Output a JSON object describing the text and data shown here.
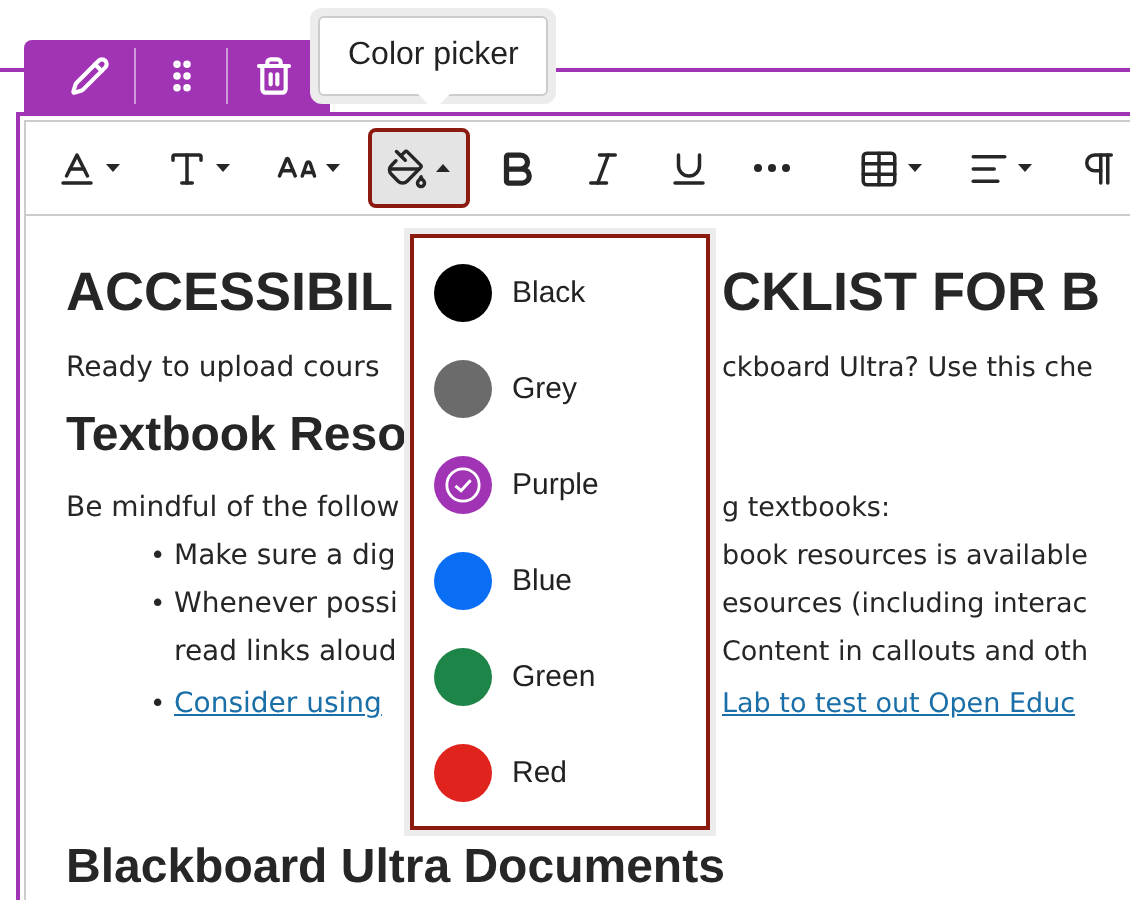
{
  "tooltip": {
    "text": "Color picker"
  },
  "block_toolbar": {
    "tools": [
      {
        "kind": "edit"
      },
      {
        "kind": "move"
      },
      {
        "kind": "delete"
      }
    ]
  },
  "toolbar": {
    "groups": [
      [
        {
          "kind": "font-style",
          "caret": true,
          "selected": false
        },
        {
          "kind": "text-type",
          "caret": true,
          "selected": false
        },
        {
          "kind": "font-size",
          "caret": true,
          "selected": false
        },
        {
          "kind": "color",
          "caret": true,
          "selected": true
        },
        {
          "kind": "bold",
          "caret": false,
          "selected": false
        },
        {
          "kind": "italic",
          "caret": false,
          "selected": false
        },
        {
          "kind": "underline",
          "caret": false,
          "selected": false
        },
        {
          "kind": "more",
          "caret": false,
          "selected": false
        }
      ],
      [
        {
          "kind": "table",
          "caret": true,
          "selected": false
        },
        {
          "kind": "align",
          "caret": true,
          "selected": false
        },
        {
          "kind": "paragraph",
          "caret": false,
          "selected": false
        }
      ]
    ]
  },
  "color_menu": {
    "items": [
      {
        "label": "Black",
        "color": "#000000",
        "selected": false
      },
      {
        "label": "Grey",
        "color": "#6b6b6b",
        "selected": false
      },
      {
        "label": "Purple",
        "color": "#a034b4",
        "selected": true
      },
      {
        "label": "Blue",
        "color": "#0a6ef5",
        "selected": false
      },
      {
        "label": "Green",
        "color": "#1e8548",
        "selected": false
      },
      {
        "label": "Red",
        "color": "#e0231c",
        "selected": false
      }
    ]
  },
  "document": {
    "lines": [
      {
        "kind": "h1",
        "left": "ACCESSIBIL",
        "right": "CKLIST FOR B"
      },
      {
        "kind": "p",
        "left": "Ready to upload cours",
        "right": "ckboard Ultra? Use this che"
      },
      {
        "kind": "h2",
        "left": "Textbook Reso"
      },
      {
        "kind": "p",
        "left": "Be mindful of the follow",
        "right": "g textbooks:"
      },
      {
        "kind": "bullet",
        "marker": "•",
        "left": "Make sure a dig",
        "right": "book resources is available"
      },
      {
        "kind": "bullet",
        "marker": "•",
        "left": "Whenever possi",
        "right": "esources (including interac"
      },
      {
        "kind": "cont",
        "left": "read links aloud",
        "right": "Content in callouts and oth"
      },
      {
        "kind": "link",
        "marker": "•",
        "left": "Consider using",
        "right": "Lab to test out Open Educ"
      },
      {
        "kind": "h2full",
        "left": "Blackboard Ultra Documents"
      }
    ]
  }
}
